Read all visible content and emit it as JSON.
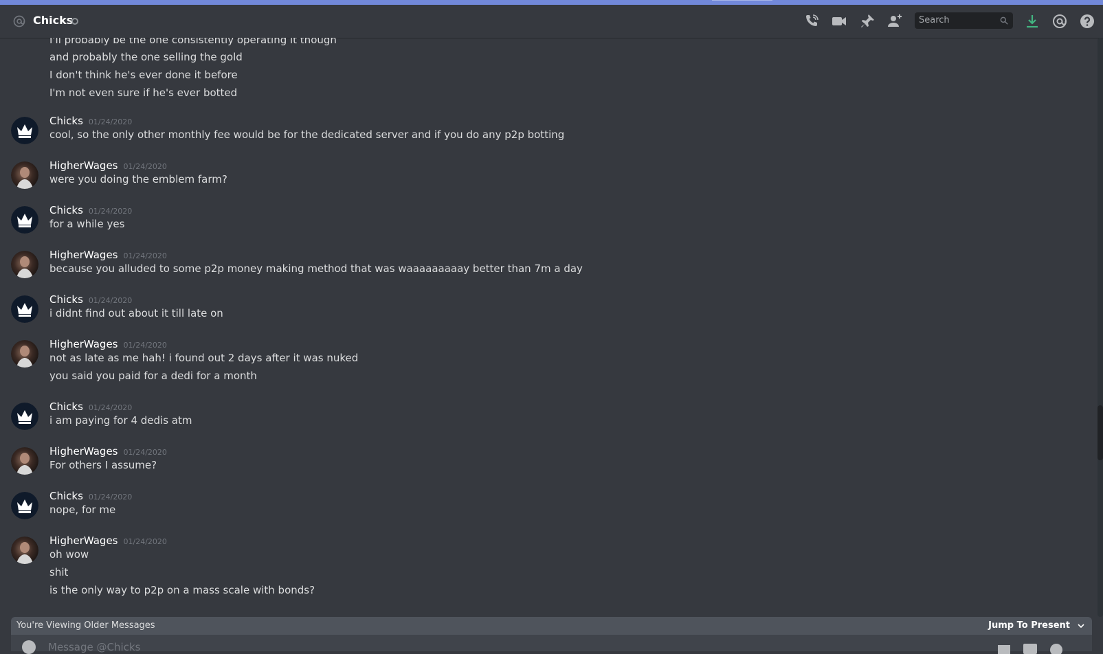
{
  "header": {
    "channel_name": "Chicks",
    "search_placeholder": "Search",
    "accent": "#7289da",
    "download_color": "#43b581"
  },
  "messages": [
    {
      "lines": [
        "I'll probably be the one consistently operating it though",
        "and probably the one selling the gold",
        "I don't think he's ever done it before",
        "I'm not even sure if he's ever botted"
      ]
    },
    {
      "author": "Chicks",
      "timestamp": "01/24/2020",
      "avatar": "crown-avatar",
      "lines": [
        "cool, so the only other monthly fee would be for the dedicated server and if you do any p2p botting"
      ]
    },
    {
      "author": "HigherWages",
      "timestamp": "01/24/2020",
      "avatar": "photo-avatar",
      "lines": [
        "were you doing the emblem farm?"
      ]
    },
    {
      "author": "Chicks",
      "timestamp": "01/24/2020",
      "avatar": "crown-avatar",
      "lines": [
        "for a while yes"
      ]
    },
    {
      "author": "HigherWages",
      "timestamp": "01/24/2020",
      "avatar": "photo-avatar",
      "lines": [
        "because you alluded to some p2p money making method that was waaaaaaaaay better than 7m a day"
      ]
    },
    {
      "author": "Chicks",
      "timestamp": "01/24/2020",
      "avatar": "crown-avatar",
      "lines": [
        "i didnt find out about it till late on"
      ]
    },
    {
      "author": "HigherWages",
      "timestamp": "01/24/2020",
      "avatar": "photo-avatar",
      "lines": [
        "not as late as me hah! i found out 2 days after it was nuked",
        "you said you paid for a dedi for a month"
      ]
    },
    {
      "author": "Chicks",
      "timestamp": "01/24/2020",
      "avatar": "crown-avatar",
      "lines": [
        "i am paying for 4 dedis atm"
      ]
    },
    {
      "author": "HigherWages",
      "timestamp": "01/24/2020",
      "avatar": "photo-avatar",
      "lines": [
        "For others I assume?"
      ]
    },
    {
      "author": "Chicks",
      "timestamp": "01/24/2020",
      "avatar": "crown-avatar",
      "lines": [
        "nope, for me"
      ]
    },
    {
      "author": "HigherWages",
      "timestamp": "01/24/2020",
      "avatar": "photo-avatar",
      "lines": [
        "oh wow",
        "shit",
        "is the only way to p2p on a mass scale with bonds?"
      ]
    }
  ],
  "older_bar": {
    "text": "You're Viewing Older Messages",
    "jump_label": "Jump To Present"
  },
  "composer": {
    "placeholder": "Message @Chicks"
  }
}
